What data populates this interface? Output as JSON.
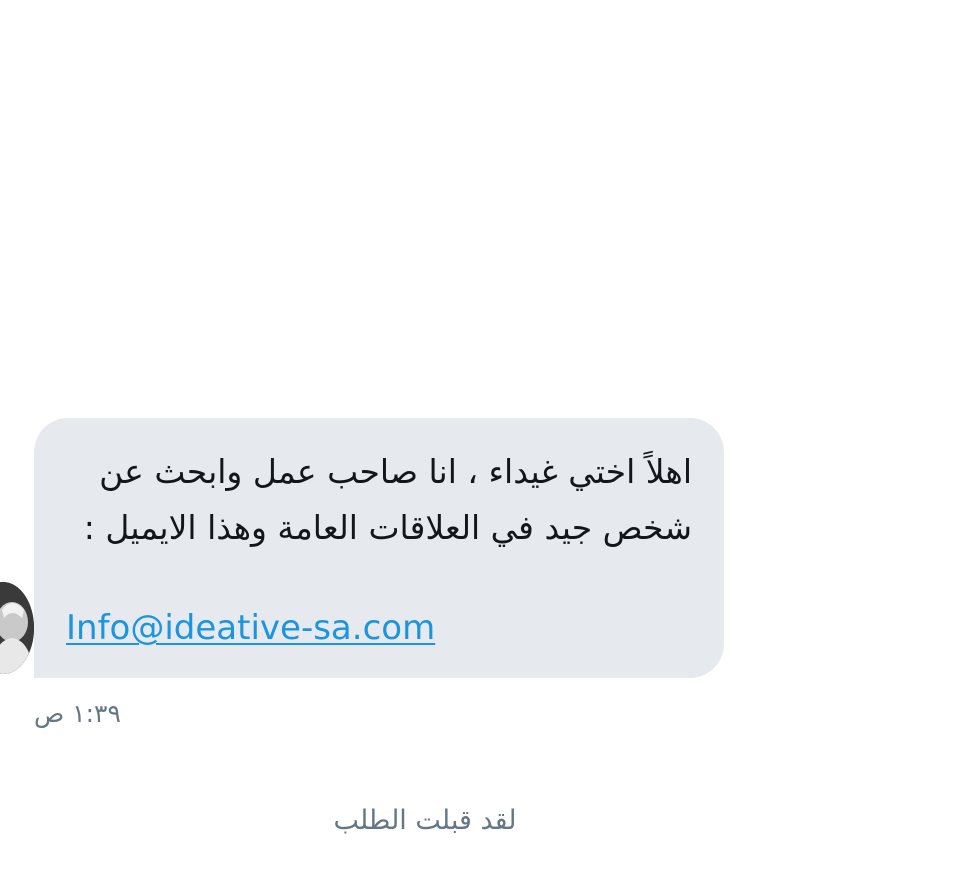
{
  "conversation": {
    "message": {
      "text": "اهلاً اختي غيداء ، انا صاحب عمل وابحث عن شخص جيد في العلاقات العامة وهذا الايميل :",
      "email_link": "Info@ideative-sa.com",
      "timestamp": "١:٣٩ ص"
    },
    "status_text": "لقد قبلت الطلب",
    "colors": {
      "bubble_background": "#e6eaef",
      "link": "#1b95e0",
      "muted_text": "#657786",
      "message_text": "#14171a"
    },
    "sender_avatar_icon": "avatar-photo"
  }
}
